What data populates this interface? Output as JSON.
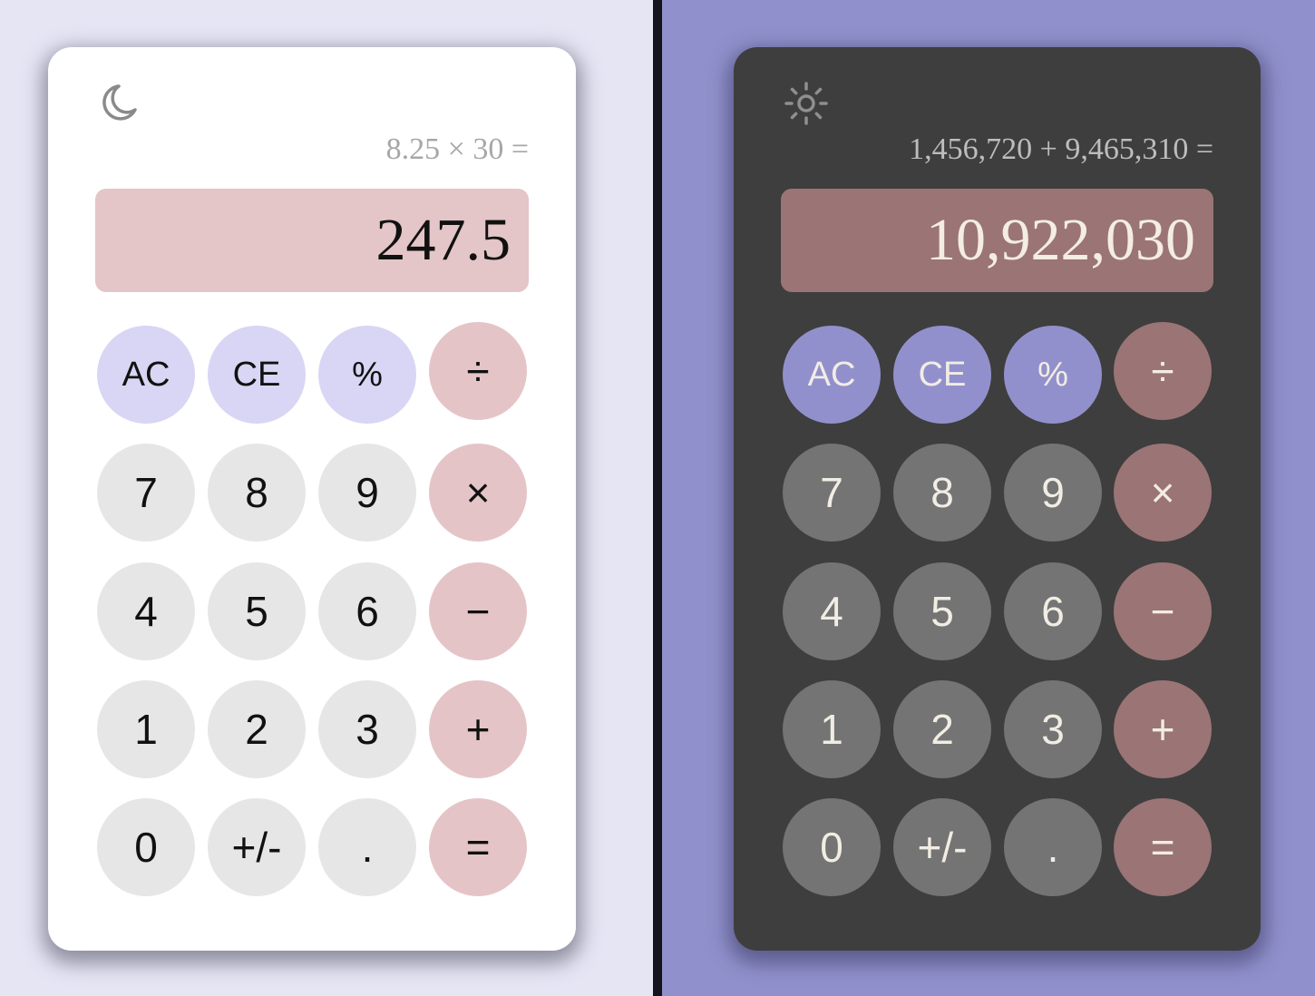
{
  "light": {
    "theme_toggle_icon": "moon-icon",
    "expression": "8.25 × 30 =",
    "display": "247.5",
    "colors": {
      "page_bg": "#e6e5f4",
      "card_bg": "#ffffff",
      "display_bg": "#e4c5c8",
      "number_key": "#e6e6e6",
      "function_key": "#d8d6f4",
      "operator_key": "#e5c4c7",
      "text": "#111111"
    },
    "keys": [
      "AC",
      "CE",
      "%",
      "÷",
      "7",
      "8",
      "9",
      "×",
      "4",
      "5",
      "6",
      "−",
      "1",
      "2",
      "3",
      "+",
      "0",
      "+/-",
      ".",
      "="
    ]
  },
  "dark": {
    "theme_toggle_icon": "sun-icon",
    "expression": "1,456,720 + 9,465,310 =",
    "display": "10,922,030",
    "colors": {
      "page_bg": "#9090cc",
      "card_bg": "#3e3e3e",
      "display_bg": "#9b7476",
      "number_key": "#747474",
      "function_key": "#9290cc",
      "operator_key": "#9b7476",
      "text": "#f2ede4"
    },
    "keys": [
      "AC",
      "CE",
      "%",
      "÷",
      "7",
      "8",
      "9",
      "×",
      "4",
      "5",
      "6",
      "−",
      "1",
      "2",
      "3",
      "+",
      "0",
      "+/-",
      ".",
      "="
    ]
  }
}
